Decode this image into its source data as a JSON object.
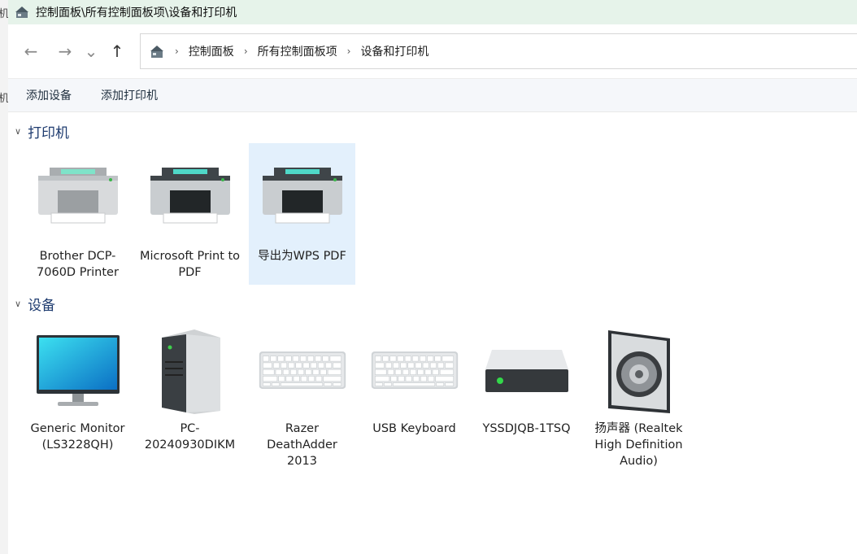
{
  "window": {
    "title": "控制面板\\所有控制面板项\\设备和打印机"
  },
  "nav": {
    "back_glyph": "←",
    "forward_glyph": "→",
    "recent_glyph": "⌄",
    "up_glyph": "↑"
  },
  "address": {
    "crumbs": [
      "控制面板",
      "所有控制面板项",
      "设备和打印机"
    ],
    "sep_glyph": "›"
  },
  "commands": {
    "add_device": "添加设备",
    "add_printer": "添加打印机"
  },
  "printers": {
    "header": "打印机",
    "items": [
      {
        "label": "Brother DCP-7060D Printer",
        "icon": "printer-icon"
      },
      {
        "label": "Microsoft Print to PDF",
        "icon": "printer-icon"
      },
      {
        "label": "导出为WPS PDF",
        "icon": "printer-icon",
        "selected": true
      }
    ]
  },
  "devices": {
    "header": "设备",
    "items": [
      {
        "label": "Generic Monitor (LS3228QH)",
        "icon": "monitor-icon"
      },
      {
        "label": "PC-20240930DIKM",
        "icon": "computer-tower-icon"
      },
      {
        "label": "Razer DeathAdder 2013",
        "icon": "keyboard-icon"
      },
      {
        "label": "USB Keyboard",
        "icon": "keyboard-icon"
      },
      {
        "label": "YSSDJQB-1TSQ",
        "icon": "drive-icon"
      },
      {
        "label": "扬声器 (Realtek High Definition Audio)",
        "icon": "speaker-icon"
      }
    ]
  },
  "left_strip": {
    "frag1": "机",
    "frag2": "机"
  },
  "colors": {
    "titlebar_bg": "#e6f3ea",
    "selected_bg": "#e3f0fc",
    "section_text": "#1e3b6f",
    "printer_accent": "#3fd6c6",
    "monitor_screen": "#1aa3d8"
  }
}
